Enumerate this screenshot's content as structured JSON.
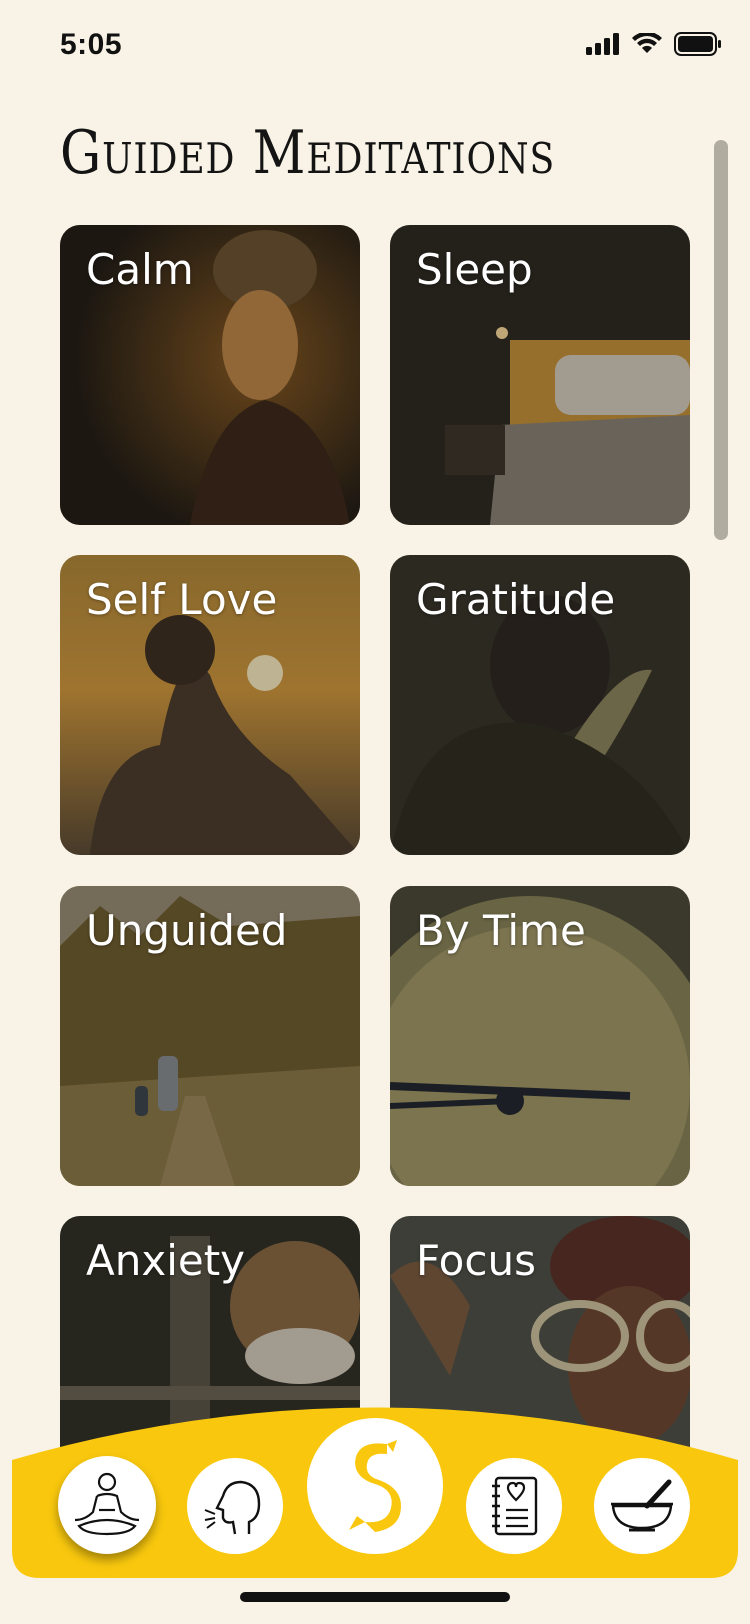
{
  "status_bar": {
    "time": "5:05"
  },
  "page": {
    "title": "Guided Meditations"
  },
  "categories": [
    {
      "label": "Calm"
    },
    {
      "label": "Sleep"
    },
    {
      "label": "Self Love"
    },
    {
      "label": "Gratitude"
    },
    {
      "label": "Unguided"
    },
    {
      "label": "By Time"
    },
    {
      "label": "Anxiety"
    },
    {
      "label": "Focus"
    }
  ],
  "tab_bar": {
    "accent": "#f9c80e",
    "items": [
      {
        "icon": "meditation-person-icon",
        "selected": true
      },
      {
        "icon": "breathing-head-icon"
      },
      {
        "icon": "app-logo-icon"
      },
      {
        "icon": "journal-heart-icon"
      },
      {
        "icon": "mortar-pestle-icon"
      }
    ]
  }
}
